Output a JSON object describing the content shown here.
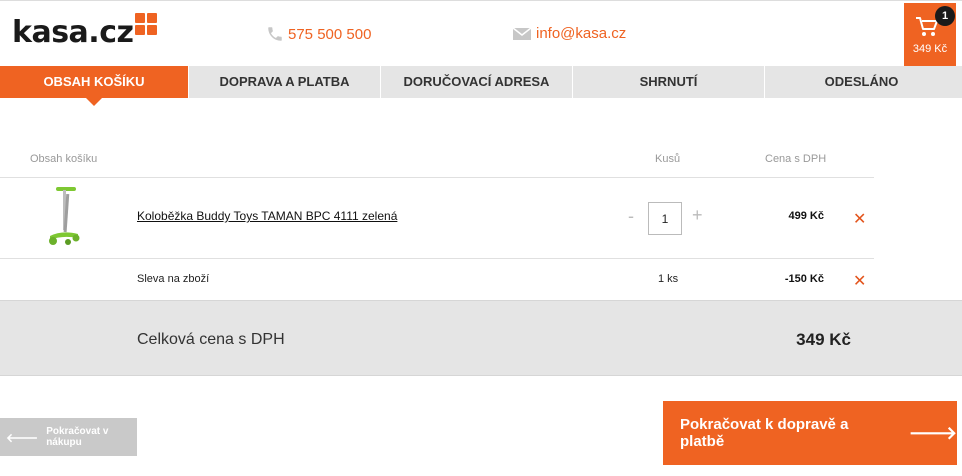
{
  "header": {
    "logo_text": "kasa.cz",
    "phone": "575 500 500",
    "email": "info@kasa.cz",
    "cart": {
      "count": "1",
      "total": "349 Kč"
    }
  },
  "steps": [
    {
      "label": "OBSAH KOŠÍKU",
      "active": true
    },
    {
      "label": "DOPRAVA A PLATBA",
      "active": false
    },
    {
      "label": "DORUČOVACÍ ADRESA",
      "active": false
    },
    {
      "label": "SHRNUTÍ",
      "active": false
    },
    {
      "label": "ODESLÁNO",
      "active": false
    }
  ],
  "table": {
    "headers": {
      "name": "Obsah košíku",
      "qty": "Kusů",
      "price": "Cena s DPH"
    },
    "product": {
      "name": "Koloběžka Buddy Toys TAMAN BPC 4111 zelená",
      "quantity": "1",
      "price": "499 Kč",
      "qty_minus": "-",
      "qty_plus": "+",
      "image_icon": "scooter-image"
    },
    "discount": {
      "name": "Sleva na zboží",
      "quantity": "1 ks",
      "price": "-150 Kč"
    },
    "remove_symbol": "✕"
  },
  "total": {
    "label": "Celková cena s DPH",
    "value": "349 Kč"
  },
  "buttons": {
    "back": "Pokračovat v nákupu",
    "next": "Pokračovat k dopravě a platbě"
  },
  "colors": {
    "accent": "#ef6322",
    "band": "#e5e5e5",
    "remove": "#e3541c"
  }
}
